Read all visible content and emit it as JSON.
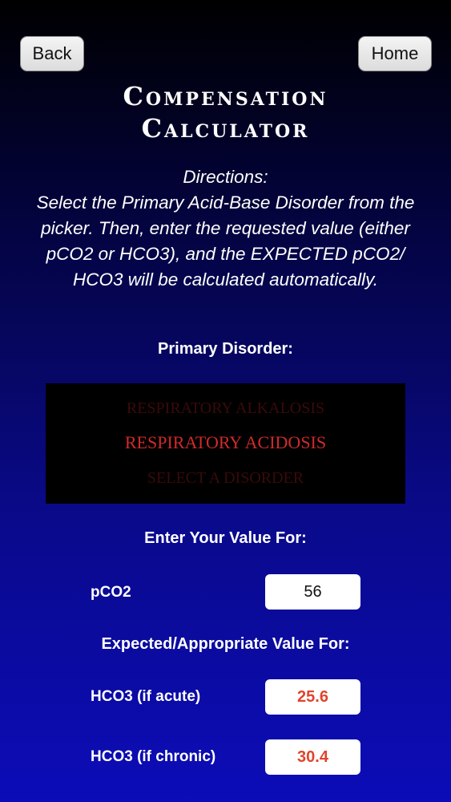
{
  "nav": {
    "back_label": "Back",
    "home_label": "Home"
  },
  "title": {
    "line1": "Compensation",
    "line2": "Calculator"
  },
  "directions": {
    "heading": "Directions:",
    "text": "Select the Primary Acid-Base Disorder from the picker. Then, enter the requested value (either pCO2 or HCO3), and the EXPECTED pCO2/ HCO3 will be calculated automatically."
  },
  "primary_disorder": {
    "label": "Primary Disorder:",
    "options_visible": {
      "above": "RESPIRATORY ALKALOSIS",
      "selected": "RESPIRATORY ACIDOSIS",
      "below": "SELECT A DISORDER"
    }
  },
  "enter_value": {
    "label": "Enter Your Value For:",
    "field_label": "pCO2",
    "field_value": "56"
  },
  "expected": {
    "label": "Expected/Appropriate Value For:",
    "acute_label": "HCO3 (if acute)",
    "acute_value": "25.6",
    "chronic_label": "HCO3 (if chronic)",
    "chronic_value": "30.4"
  },
  "colors": {
    "background_top": "#000000",
    "background_bottom": "#0c0cb8",
    "picker_selected": "#d12a2a",
    "result_text": "#e0442c"
  }
}
